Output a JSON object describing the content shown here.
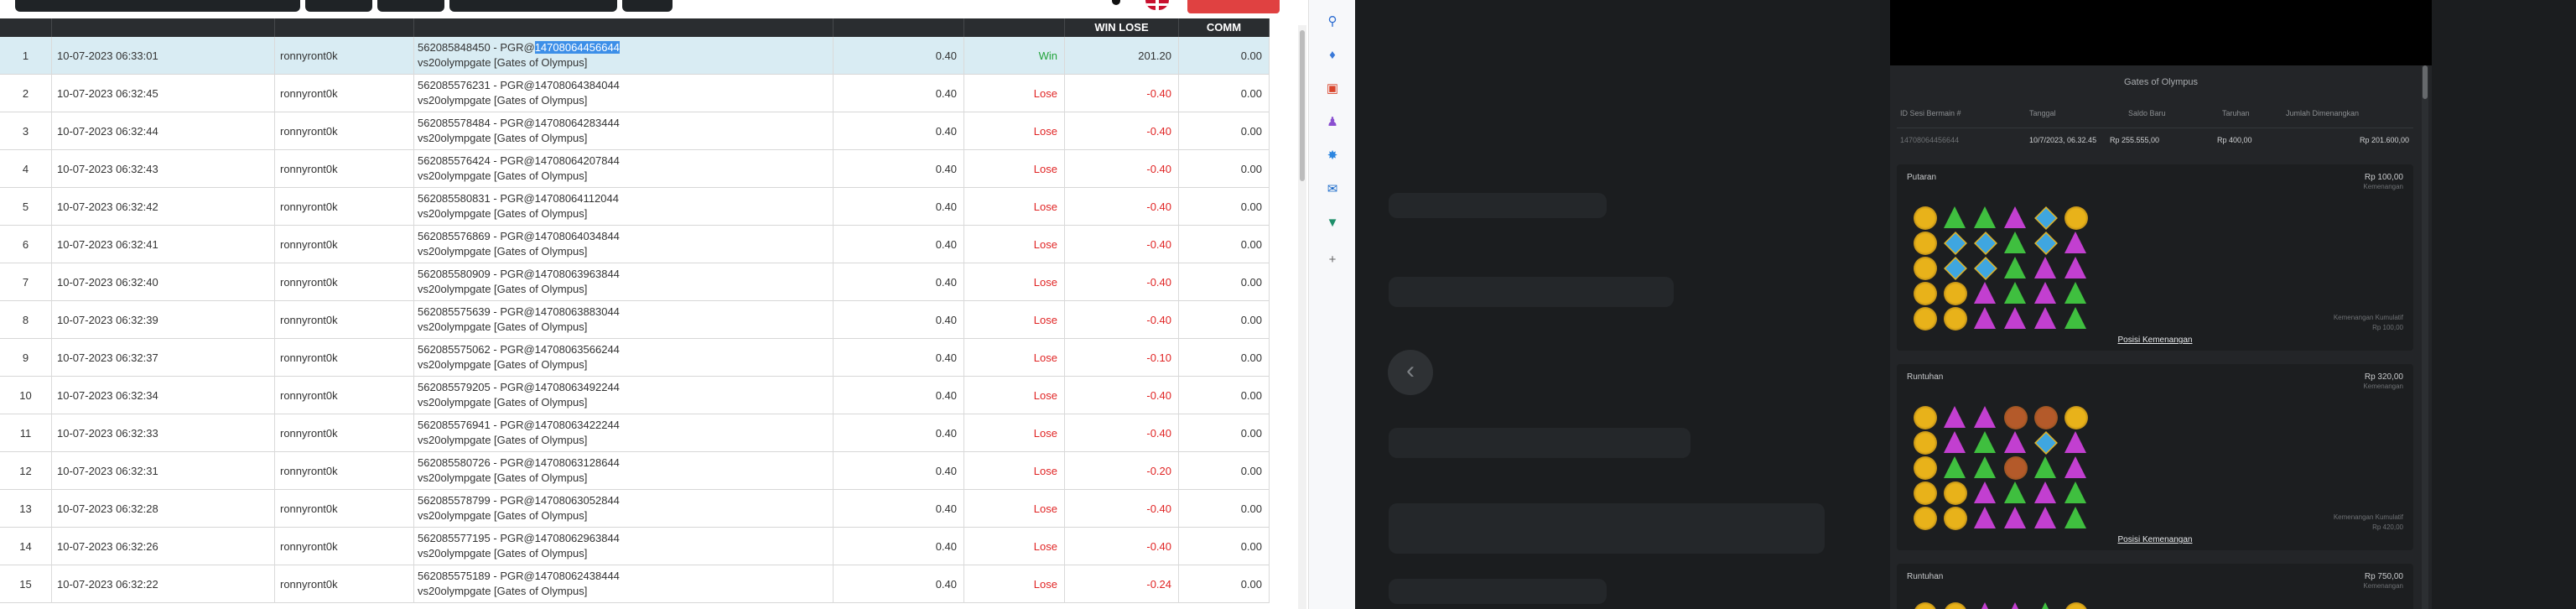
{
  "table": {
    "headers": {
      "no": "",
      "date": "",
      "user": "",
      "description": "",
      "bet": "",
      "result": "",
      "win_lose": "WIN LOSE",
      "comm": "COMM"
    },
    "rows": [
      {
        "no": "1",
        "date": "10-07-2023 06:33:01",
        "user": "ronnyront0k",
        "desc_prefix": "562085848450 - PGR@",
        "desc_highlight": "14708064456644",
        "desc_line2": "vs20olympgate [Gates of Olympus]",
        "bet": "0.40",
        "result": "Win",
        "win_lose": "201.20",
        "comm": "0.00"
      },
      {
        "no": "2",
        "date": "10-07-2023 06:32:45",
        "user": "ronnyront0k",
        "desc_prefix": "562085576231 - PGR@14708064384044",
        "desc_highlight": "",
        "desc_line2": "vs20olympgate [Gates of Olympus]",
        "bet": "0.40",
        "result": "Lose",
        "win_lose": "-0.40",
        "comm": "0.00"
      },
      {
        "no": "3",
        "date": "10-07-2023 06:32:44",
        "user": "ronnyront0k",
        "desc_prefix": "562085578484 - PGR@14708064283444",
        "desc_highlight": "",
        "desc_line2": "vs20olympgate [Gates of Olympus]",
        "bet": "0.40",
        "result": "Lose",
        "win_lose": "-0.40",
        "comm": "0.00"
      },
      {
        "no": "4",
        "date": "10-07-2023 06:32:43",
        "user": "ronnyront0k",
        "desc_prefix": "562085576424 - PGR@14708064207844",
        "desc_highlight": "",
        "desc_line2": "vs20olympgate [Gates of Olympus]",
        "bet": "0.40",
        "result": "Lose",
        "win_lose": "-0.40",
        "comm": "0.00"
      },
      {
        "no": "5",
        "date": "10-07-2023 06:32:42",
        "user": "ronnyront0k",
        "desc_prefix": "562085580831 - PGR@14708064112044",
        "desc_highlight": "",
        "desc_line2": "vs20olympgate [Gates of Olympus]",
        "bet": "0.40",
        "result": "Lose",
        "win_lose": "-0.40",
        "comm": "0.00"
      },
      {
        "no": "6",
        "date": "10-07-2023 06:32:41",
        "user": "ronnyront0k",
        "desc_prefix": "562085576869 - PGR@14708064034844",
        "desc_highlight": "",
        "desc_line2": "vs20olympgate [Gates of Olympus]",
        "bet": "0.40",
        "result": "Lose",
        "win_lose": "-0.40",
        "comm": "0.00"
      },
      {
        "no": "7",
        "date": "10-07-2023 06:32:40",
        "user": "ronnyront0k",
        "desc_prefix": "562085580909 - PGR@14708063963844",
        "desc_highlight": "",
        "desc_line2": "vs20olympgate [Gates of Olympus]",
        "bet": "0.40",
        "result": "Lose",
        "win_lose": "-0.40",
        "comm": "0.00"
      },
      {
        "no": "8",
        "date": "10-07-2023 06:32:39",
        "user": "ronnyront0k",
        "desc_prefix": "562085575639 - PGR@14708063883044",
        "desc_highlight": "",
        "desc_line2": "vs20olympgate [Gates of Olympus]",
        "bet": "0.40",
        "result": "Lose",
        "win_lose": "-0.40",
        "comm": "0.00"
      },
      {
        "no": "9",
        "date": "10-07-2023 06:32:37",
        "user": "ronnyront0k",
        "desc_prefix": "562085575062 - PGR@14708063566244",
        "desc_highlight": "",
        "desc_line2": "vs20olympgate [Gates of Olympus]",
        "bet": "0.40",
        "result": "Lose",
        "win_lose": "-0.10",
        "comm": "0.00"
      },
      {
        "no": "10",
        "date": "10-07-2023 06:32:34",
        "user": "ronnyront0k",
        "desc_prefix": "562085579205 - PGR@14708063492244",
        "desc_highlight": "",
        "desc_line2": "vs20olympgate [Gates of Olympus]",
        "bet": "0.40",
        "result": "Lose",
        "win_lose": "-0.40",
        "comm": "0.00"
      },
      {
        "no": "11",
        "date": "10-07-2023 06:32:33",
        "user": "ronnyront0k",
        "desc_prefix": "562085576941 - PGR@14708063422244",
        "desc_highlight": "",
        "desc_line2": "vs20olympgate [Gates of Olympus]",
        "bet": "0.40",
        "result": "Lose",
        "win_lose": "-0.40",
        "comm": "0.00"
      },
      {
        "no": "12",
        "date": "10-07-2023 06:32:31",
        "user": "ronnyront0k",
        "desc_prefix": "562085580726 - PGR@14708063128644",
        "desc_highlight": "",
        "desc_line2": "vs20olympgate [Gates of Olympus]",
        "bet": "0.40",
        "result": "Lose",
        "win_lose": "-0.20",
        "comm": "0.00"
      },
      {
        "no": "13",
        "date": "10-07-2023 06:32:28",
        "user": "ronnyront0k",
        "desc_prefix": "562085578799 - PGR@14708063052844",
        "desc_highlight": "",
        "desc_line2": "vs20olympgate [Gates of Olympus]",
        "bet": "0.40",
        "result": "Lose",
        "win_lose": "-0.40",
        "comm": "0.00"
      },
      {
        "no": "14",
        "date": "10-07-2023 06:32:26",
        "user": "ronnyront0k",
        "desc_prefix": "562085577195 - PGR@14708062963844",
        "desc_highlight": "",
        "desc_line2": "vs20olympgate [Gates of Olympus]",
        "bet": "0.40",
        "result": "Lose",
        "win_lose": "-0.40",
        "comm": "0.00"
      },
      {
        "no": "15",
        "date": "10-07-2023 06:32:22",
        "user": "ronnyront0k",
        "desc_prefix": "562085575189 - PGR@14708062438444",
        "desc_highlight": "",
        "desc_line2": "vs20olympgate [Gates of Olympus]",
        "bet": "0.40",
        "result": "Lose",
        "win_lose": "-0.24",
        "comm": "0.00"
      }
    ]
  },
  "sidebar_icons": [
    "search-icon",
    "tag-icon",
    "toolbox-icon",
    "people-icon",
    "copilot-icon",
    "outlook-icon",
    "cart-icon",
    "add-icon"
  ],
  "popup": {
    "title": "Gates of Olympus",
    "columns": [
      "ID Sesi Bermain #",
      "Tanggal",
      "Saldo Baru",
      "Taruhan",
      "Jumlah Dimenangkan"
    ],
    "values": [
      "14708064456644",
      "10/7/2023, 06.32.45",
      "Rp 255.555,00",
      "Rp 400,00",
      "Rp 201.600,00"
    ],
    "sections": [
      {
        "title": "Putaran",
        "amount": "Rp 100,00",
        "sub": "Kemenangan",
        "foot1": "Kemenangan Kumulatif",
        "foot2": "Rp 100,00",
        "link": "Posisi Kemenangan"
      },
      {
        "title": "Runtuhan",
        "amount": "Rp 320,00",
        "sub": "Kemenangan",
        "foot1": "Kemenangan Kumulatif",
        "foot2": "Rp 420,00",
        "link": "Posisi Kemenangan"
      },
      {
        "title": "Runtuhan",
        "amount": "Rp 750,00",
        "sub": "Kemenangan",
        "foot1": "",
        "foot2": "",
        "link": ""
      }
    ]
  },
  "colors": {
    "accent": "#3d8fe8",
    "win": "#22a33a",
    "lose": "#e02424",
    "header_bg": "#2a2d30",
    "popup_bg": "#232528"
  }
}
